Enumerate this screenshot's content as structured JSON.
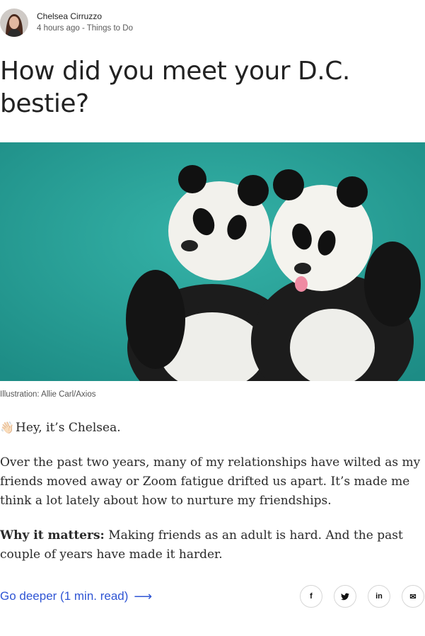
{
  "byline": {
    "author": "Chelsea Cirruzzo",
    "time": "4 hours ago",
    "separator": " - ",
    "section": "Things to Do"
  },
  "headline": "How did you meet your D.C. bestie?",
  "hero": {
    "caption": "Illustration: Allie Carl/Axios"
  },
  "body": {
    "intro_emoji": "👋🏻",
    "intro": "Hey, it’s Chelsea.",
    "p1": "Over the past two years, many of my relationships have wilted as my friends moved away or Zoom fatigue drifted us apart. It’s made me think a lot lately about how to nurture my friendships.",
    "why_label": "Why it matters:",
    "why_text": " Making friends as an adult is hard. And the past couple of years have made it harder."
  },
  "footer": {
    "go_deeper": "Go deeper (1 min. read)",
    "arrow": "⟶",
    "share": {
      "facebook": "f",
      "twitter": "🐦",
      "linkedin": "in",
      "email": "✉"
    }
  },
  "colors": {
    "link": "#2f55d4",
    "hero_bg": "#2aa59b"
  }
}
